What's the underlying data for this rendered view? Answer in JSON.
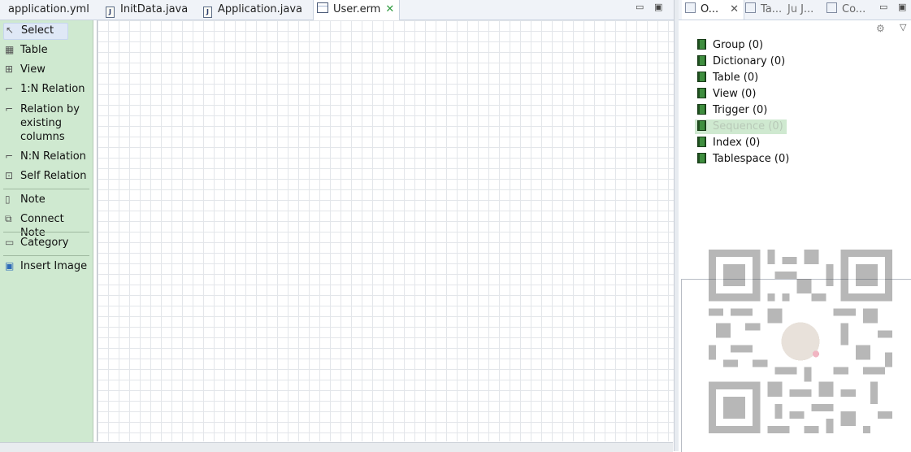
{
  "editor_tabs": [
    {
      "label": "application.yml",
      "icon": "yml-file-icon"
    },
    {
      "label": "InitData.java",
      "icon": "java-file-icon"
    },
    {
      "label": "Application.java",
      "icon": "java-file-icon"
    },
    {
      "label": "User.erm",
      "icon": "erm-file-icon",
      "active": true
    }
  ],
  "palette": {
    "items": [
      {
        "label": "Select",
        "icon": "pointer-icon"
      },
      {
        "label": "Table",
        "icon": "table-icon"
      },
      {
        "label": "View",
        "icon": "view-icon"
      },
      {
        "label": "1:N Relation",
        "icon": "relation-icon"
      },
      {
        "label": "Relation by existing columns",
        "icon": "relation-icon"
      },
      {
        "label": "N:N Relation",
        "icon": "relation-icon"
      },
      {
        "label": "Self Relation",
        "icon": "self-relation-icon"
      },
      {
        "label": "Note",
        "icon": "note-icon"
      },
      {
        "label": "Connect Note",
        "icon": "connect-note-icon"
      },
      {
        "label": "Category",
        "icon": "category-icon"
      },
      {
        "label": "Insert Image",
        "icon": "image-icon"
      }
    ]
  },
  "right_tabs": [
    {
      "label": "O..."
    },
    {
      "label": "Ta..."
    },
    {
      "label": "J..."
    },
    {
      "label": "Co..."
    }
  ],
  "outline": {
    "items": [
      {
        "label": "Group (0)"
      },
      {
        "label": "Dictionary (0)"
      },
      {
        "label": "Table (0)"
      },
      {
        "label": "View (0)"
      },
      {
        "label": "Trigger (0)"
      },
      {
        "label": "Sequence (0)"
      },
      {
        "label": "Index (0)"
      },
      {
        "label": "Tablespace (0)"
      }
    ]
  },
  "colors": {
    "palette_bg": "#cfe9d0",
    "canvas_grid": "#e3e6ea",
    "tab_bar": "#f0f3f8"
  }
}
